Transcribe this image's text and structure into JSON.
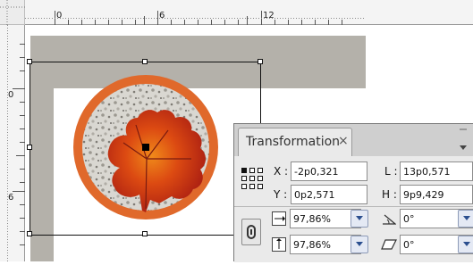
{
  "rulers": {
    "horizontal_labels": [
      "0",
      "6",
      "12"
    ],
    "vertical_labels": [
      "0",
      "6"
    ]
  },
  "panel": {
    "title": "Transformation",
    "close_glyph": "×",
    "x_label": "X :",
    "x_value": "-2p0,321",
    "y_label": "Y :",
    "y_value": "0p2,571",
    "w_label": "L :",
    "w_value": "13p0,571",
    "h_label": "H :",
    "h_value": "9p9,429",
    "scale_x_value": "97,86%",
    "scale_y_value": "97,86%",
    "rotation_value": "0°",
    "shear_value": "0°",
    "icons": [
      "reference-point-icon",
      "constrain-proportions-icon",
      "scale-x-icon",
      "scale-y-icon",
      "rotate-icon",
      "shear-icon",
      "panel-menu-icon"
    ]
  },
  "colors": {
    "accent_orange": "#e0692b",
    "bleed_gray": "#b4b1aa",
    "panel_bg": "#eaeaea"
  }
}
